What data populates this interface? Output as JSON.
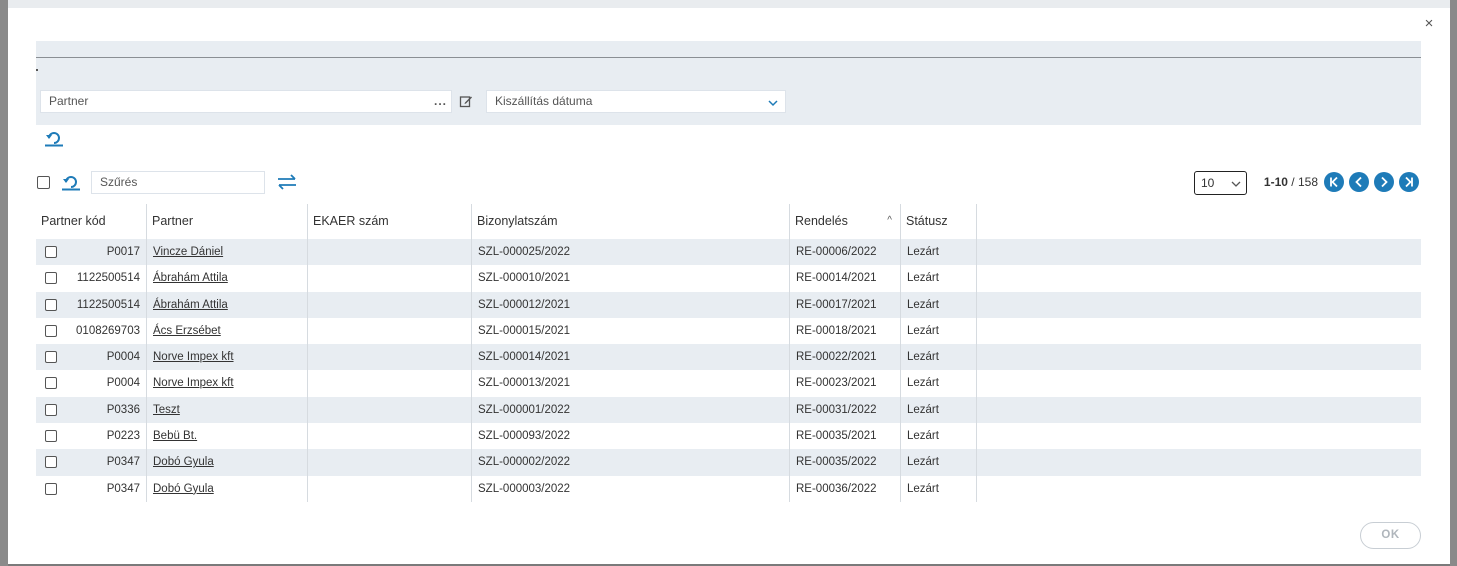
{
  "modal": {
    "close_glyph": "×",
    "ok_label": "OK"
  },
  "filters": {
    "partner_placeholder": "Partner",
    "partner_more": "...",
    "date_select_value": "Kiszállítás dátuma"
  },
  "toolbar": {
    "filter_placeholder": "Szűrés"
  },
  "pager": {
    "page_size": "10",
    "range": "1-10",
    "separator": " / ",
    "total": "158"
  },
  "icons": {
    "edit": "edit-icon",
    "reset": "undo-icon",
    "swap": "swap-arrows-icon",
    "first": "first-page-icon",
    "prev": "prev-page-icon",
    "next": "next-page-icon",
    "last": "last-page-icon"
  },
  "colors": {
    "accent": "#1e7bb8",
    "stripe": "#e8edf2"
  },
  "table": {
    "columns": [
      "Partner kód",
      "Partner",
      "EKAER szám",
      "Bizonylatszám",
      "Rendelés",
      "Státusz"
    ],
    "sort_glyph": "^",
    "rows": [
      {
        "code": "P0017",
        "partner": "Vincze Dániel",
        "ekaer": "",
        "doc": "SZL-000025/2022",
        "order": "RE-00006/2022",
        "status": "Lezárt"
      },
      {
        "code": "1122500514",
        "partner": "Ábrahám Attila",
        "ekaer": "",
        "doc": "SZL-000010/2021",
        "order": "RE-00014/2021",
        "status": "Lezárt"
      },
      {
        "code": "1122500514",
        "partner": "Ábrahám Attila",
        "ekaer": "",
        "doc": "SZL-000012/2021",
        "order": "RE-00017/2021",
        "status": "Lezárt"
      },
      {
        "code": "0108269703",
        "partner": "Ács Erzsébet",
        "ekaer": "",
        "doc": "SZL-000015/2021",
        "order": "RE-00018/2021",
        "status": "Lezárt"
      },
      {
        "code": "P0004",
        "partner": "Norve Impex kft",
        "ekaer": "",
        "doc": "SZL-000014/2021",
        "order": "RE-00022/2021",
        "status": "Lezárt"
      },
      {
        "code": "P0004",
        "partner": "Norve Impex kft",
        "ekaer": "",
        "doc": "SZL-000013/2021",
        "order": "RE-00023/2021",
        "status": "Lezárt"
      },
      {
        "code": "P0336",
        "partner": "Teszt",
        "ekaer": "",
        "doc": "SZL-000001/2022",
        "order": "RE-00031/2022",
        "status": "Lezárt"
      },
      {
        "code": "P0223",
        "partner": "Bebü Bt.",
        "ekaer": "",
        "doc": "SZL-000093/2022",
        "order": "RE-00035/2021",
        "status": "Lezárt"
      },
      {
        "code": "P0347",
        "partner": "Dobó Gyula",
        "ekaer": "",
        "doc": "SZL-000002/2022",
        "order": "RE-00035/2022",
        "status": "Lezárt"
      },
      {
        "code": "P0347",
        "partner": "Dobó Gyula",
        "ekaer": "",
        "doc": "SZL-000003/2022",
        "order": "RE-00036/2022",
        "status": "Lezárt"
      }
    ]
  }
}
